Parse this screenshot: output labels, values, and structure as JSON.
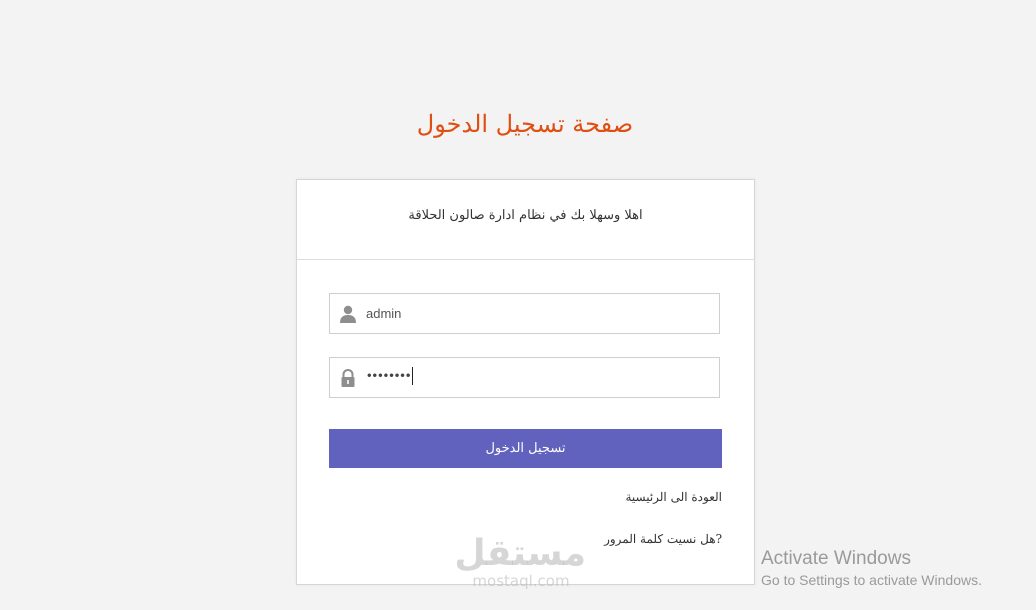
{
  "page": {
    "title": "صفحة تسجيل الدخول",
    "title_color": "#e04e12"
  },
  "card": {
    "welcome": "اهلا وسهلا بك في نظام ادارة صالون الحلاقة"
  },
  "form": {
    "username": {
      "value": "admin",
      "icon": "user-icon"
    },
    "password": {
      "masked_value": "••••••••",
      "icon": "lock-icon"
    },
    "submit_label": "تسجيل الدخول",
    "submit_color": "#6162be"
  },
  "links": {
    "home": "العودة الى الرئيسية",
    "forgot": "?هل نسيت كلمة المرور"
  },
  "watermark": {
    "arabic": "مستقل",
    "latin": "mostaql.com"
  },
  "os_notice": {
    "line1": "Activate Windows",
    "line2": "Go to Settings to activate Windows."
  }
}
